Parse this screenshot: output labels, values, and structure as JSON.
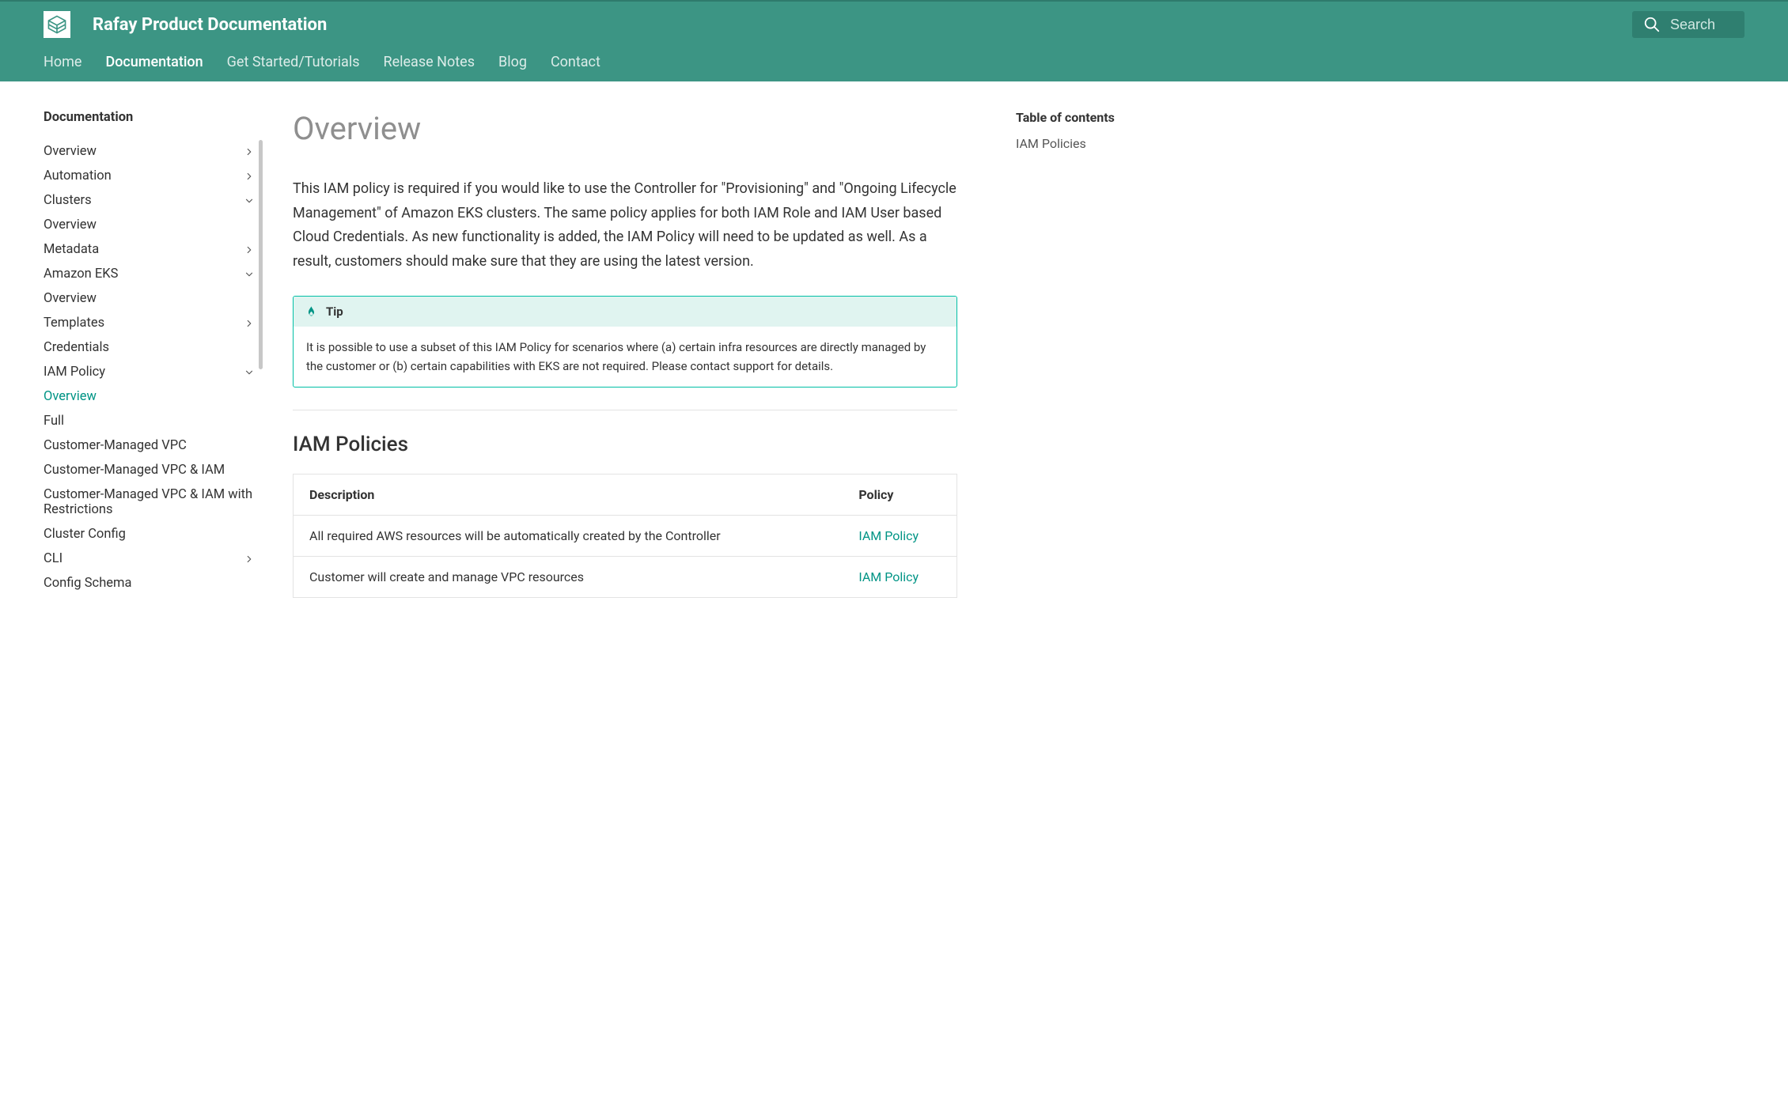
{
  "header": {
    "site_title": "Rafay Product Documentation",
    "search_placeholder": "Search",
    "tabs": [
      {
        "label": "Home",
        "active": false
      },
      {
        "label": "Documentation",
        "active": true
      },
      {
        "label": "Get Started/Tutorials",
        "active": false
      },
      {
        "label": "Release Notes",
        "active": false
      },
      {
        "label": "Blog",
        "active": false
      },
      {
        "label": "Contact",
        "active": false
      }
    ]
  },
  "sidebar": {
    "title": "Documentation",
    "items": [
      {
        "label": "Overview",
        "chev": "right",
        "depth": 0
      },
      {
        "label": "Automation",
        "chev": "right",
        "depth": 0
      },
      {
        "label": "Clusters",
        "chev": "down",
        "depth": 0
      },
      {
        "label": "Overview",
        "chev": "",
        "depth": 1
      },
      {
        "label": "Metadata",
        "chev": "right",
        "depth": 1
      },
      {
        "label": "Amazon EKS",
        "chev": "down",
        "depth": 1
      },
      {
        "label": "Overview",
        "chev": "",
        "depth": 2
      },
      {
        "label": "Templates",
        "chev": "right",
        "depth": 2
      },
      {
        "label": "Credentials",
        "chev": "",
        "depth": 2
      },
      {
        "label": "IAM Policy",
        "chev": "down",
        "depth": 2
      },
      {
        "label": "Overview",
        "chev": "",
        "depth": 3,
        "active": true
      },
      {
        "label": "Full",
        "chev": "",
        "depth": 3
      },
      {
        "label": "Customer-Managed VPC",
        "chev": "",
        "depth": 3
      },
      {
        "label": "Customer-Managed VPC & IAM",
        "chev": "",
        "depth": 3
      },
      {
        "label": "Customer-Managed VPC & IAM with Restrictions",
        "chev": "",
        "depth": 3
      },
      {
        "label": "Cluster Config",
        "chev": "",
        "depth": 2
      },
      {
        "label": "CLI",
        "chev": "right",
        "depth": 2
      },
      {
        "label": "Config Schema",
        "chev": "",
        "depth": 2
      }
    ]
  },
  "main": {
    "title": "Overview",
    "lead": "This IAM policy is required if you would like to use the Controller for \"Provisioning\" and \"Ongoing Lifecycle Management\" of Amazon EKS clusters. The same policy applies for both IAM Role and IAM User based Cloud Credentials. As new functionality is added, the IAM Policy will need to be updated as well. As a result, customers should make sure that they are using the latest version.",
    "tip": {
      "label": "Tip",
      "body": "It is possible to use a subset of this IAM Policy for scenarios where (a) certain infra resources are directly managed by the customer or (b) certain capabilities with EKS are not required. Please contact support for details."
    },
    "section_heading": "IAM Policies",
    "table": {
      "headers": {
        "description": "Description",
        "policy": "Policy"
      },
      "rows": [
        {
          "description": "All required AWS resources will be automatically created by the Controller",
          "policy": "IAM Policy"
        },
        {
          "description": "Customer will create and manage VPC resources",
          "policy": "IAM Policy"
        }
      ]
    }
  },
  "toc": {
    "title": "Table of contents",
    "items": [
      {
        "label": "IAM Policies"
      }
    ]
  }
}
